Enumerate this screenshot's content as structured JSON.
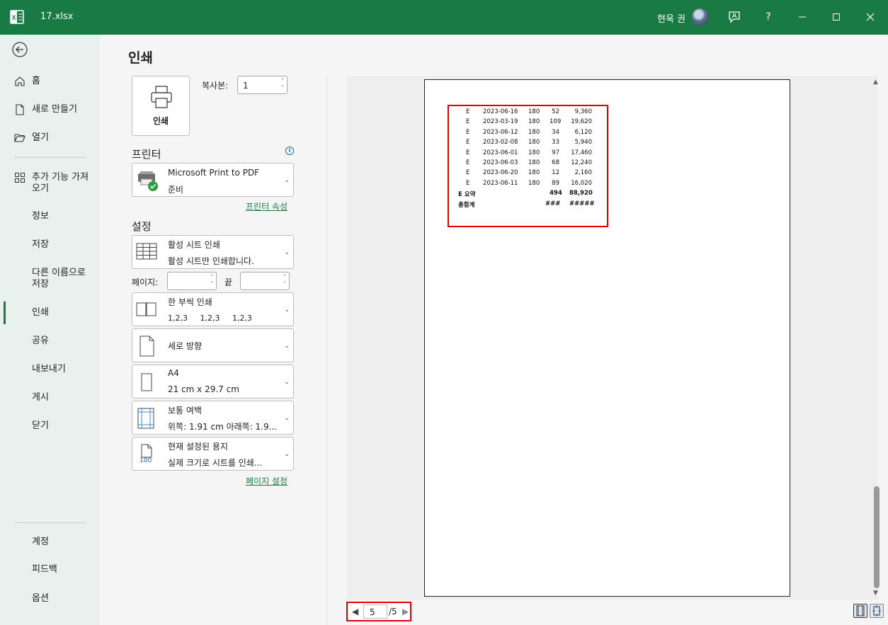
{
  "app": {
    "filename": "17.xlsx",
    "username": "현욱 권",
    "help": "?"
  },
  "nav": {
    "items": [
      {
        "label": "홈",
        "icon": "home-icon"
      },
      {
        "label": "새로 만들기",
        "icon": "new-file-icon"
      },
      {
        "label": "열기",
        "icon": "folder-open-icon"
      },
      {
        "label": "추가 기능 가져",
        "label2": "오기",
        "icon": "addins-icon"
      },
      {
        "label": "정보"
      },
      {
        "label": "저장"
      },
      {
        "label": "다른 이름으로",
        "label2": "저장"
      },
      {
        "label": "인쇄"
      },
      {
        "label": "공유"
      },
      {
        "label": "내보내기"
      },
      {
        "label": "게시"
      },
      {
        "label": "닫기"
      }
    ],
    "bottom": [
      {
        "label": "계정"
      },
      {
        "label": "피드백"
      },
      {
        "label": "옵션"
      }
    ]
  },
  "print": {
    "title": "인쇄",
    "print_button": "인쇄",
    "copies_label": "복사본:",
    "copies_value": "1",
    "printer_section": "프린터",
    "printer_name": "Microsoft Print to PDF",
    "printer_status": "준비",
    "printer_props": "프린터 속성",
    "settings_section": "설정",
    "what_title": "활성 시트 인쇄",
    "what_desc": "활성 시트만 인쇄합니다.",
    "pages_label": "페이지:",
    "to_label": "끝",
    "collate_title": "한 부씩 인쇄",
    "collate_desc": "1,2,3     1,2,3     1,2,3",
    "orientation": "세로 방향",
    "paper_title": "A4",
    "paper_desc": "21 cm x 29.7 cm",
    "margins_title": "보통 여백",
    "margins_desc": "위쪽: 1.91 cm 아래쪽: 1.9...",
    "scaling_title": "현재 설정된 용지",
    "scaling_desc": "실제 크기로 시트를 인쇄...",
    "scaling_icon_text": "100",
    "page_setup": "페이지 설정"
  },
  "preview": {
    "rows": [
      {
        "cat": "E",
        "date": "2023-06-16",
        "a": "180",
        "b": "52",
        "c": "9,360"
      },
      {
        "cat": "E",
        "date": "2023-03-19",
        "a": "180",
        "b": "109",
        "c": "19,620"
      },
      {
        "cat": "E",
        "date": "2023-06-12",
        "a": "180",
        "b": "34",
        "c": "6,120"
      },
      {
        "cat": "E",
        "date": "2023-02-08",
        "a": "180",
        "b": "33",
        "c": "5,940"
      },
      {
        "cat": "E",
        "date": "2023-06-01",
        "a": "180",
        "b": "97",
        "c": "17,460"
      },
      {
        "cat": "E",
        "date": "2023-06-03",
        "a": "180",
        "b": "68",
        "c": "12,240"
      },
      {
        "cat": "E",
        "date": "2023-06-20",
        "a": "180",
        "b": "12",
        "c": "2,160"
      },
      {
        "cat": "E",
        "date": "2023-06-11",
        "a": "180",
        "b": "89",
        "c": "16,020"
      }
    ],
    "summary": {
      "label": "E 요약",
      "b": "494",
      "c": "88,920"
    },
    "total": {
      "label": "총합계",
      "b": "###",
      "c": "#####"
    },
    "current_page": "5",
    "total_pages": "/5"
  }
}
